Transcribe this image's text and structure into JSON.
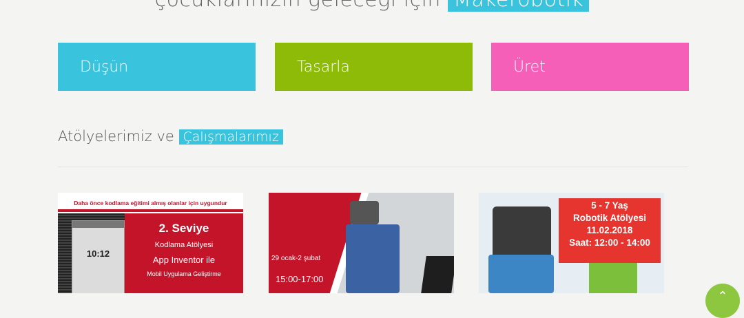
{
  "hero": {
    "text": "çocuklarınızın geleceği için",
    "highlight": "Makerobotik"
  },
  "tiles": [
    {
      "label": "Düşün",
      "color": "#39c3dd"
    },
    {
      "label": "Tasarla",
      "color": "#8dbb07"
    },
    {
      "label": "Üret",
      "color": "#f55fb8"
    }
  ],
  "section": {
    "text": "Atölyelerimiz ve",
    "highlight": "Çalışmalarımız"
  },
  "cards": [
    {
      "top_note": "Daha önce kodlama eğitimi almış olanlar için uygundur",
      "phone_time": "10:12",
      "title": "2. Seviye",
      "line2": "Kodlama Atölyesi",
      "line3": "App Inventor ile",
      "line4": "Mobil Uygulama Geliştirme"
    },
    {
      "date": "29 ocak-2 şubat",
      "time": "15:00-17:00"
    },
    {
      "line1": "5 - 7 Yaş",
      "line2": "Robotik Atölyesi",
      "line3": "11.02.2018",
      "line4": "Saat: 12:00 - 14:00"
    }
  ],
  "scroll_top_icon": "chevron-up-icon",
  "colors": {
    "accent": "#39c3dd",
    "red": "#c3142a"
  }
}
